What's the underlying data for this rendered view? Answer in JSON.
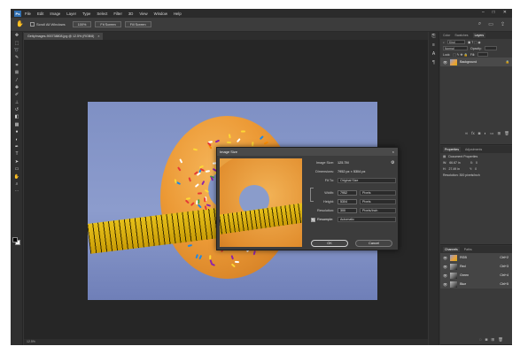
{
  "menubar": {
    "logo": "Ps",
    "items": [
      "File",
      "Edit",
      "Image",
      "Layer",
      "Type",
      "Select",
      "Filter",
      "3D",
      "View",
      "Window",
      "Help"
    ],
    "window_controls": [
      "–",
      "□",
      "✕"
    ]
  },
  "options": {
    "scroll_all": "Scroll All Windows",
    "zoom_100": "100%",
    "fit_screen": "Fit Screen",
    "fill_screen": "Fill Screen"
  },
  "document": {
    "tab_title": "GettyImages-900738808.jpg @ 12.5% (RGB/8)",
    "tab_close": "×",
    "status": "12.5%"
  },
  "panels": {
    "layers_tabs": [
      "Color",
      "Swatches",
      "Layers"
    ],
    "layers_active": "Layers",
    "kind_label": "Kind",
    "normal": "Normal",
    "opacity": "Opacity:",
    "lock": "Lock:",
    "fill": "Fill:",
    "layer_name": "Background",
    "properties_tabs": [
      "Properties",
      "Adjustments"
    ],
    "doc_props": "Document Properties",
    "w_label": "W:",
    "w_value": "66.67 in",
    "h_label": "H:",
    "h_value": "27.49 in",
    "x_label": "X:",
    "x_value": "0",
    "y_label": "Y:",
    "y_value": "0",
    "resolution": "Resolution: 300 pixels/inch",
    "channels_tabs": [
      "Channels",
      "Paths"
    ],
    "channels": [
      {
        "name": "RGB",
        "shortcut": "Ctrl+2"
      },
      {
        "name": "Red",
        "shortcut": "Ctrl+3"
      },
      {
        "name": "Green",
        "shortcut": "Ctrl+4"
      },
      {
        "name": "Blue",
        "shortcut": "Ctrl+5"
      }
    ]
  },
  "dialog": {
    "title": "Image Size",
    "close": "×",
    "image_size_label": "Image Size:",
    "image_size_value": "125.7M",
    "dimensions_label": "Dimensions:",
    "dimensions_value": "7952 px × 5304 px",
    "fit_to_label": "Fit To:",
    "fit_to_value": "Original Size",
    "width_label": "Width:",
    "width_value": "7952",
    "width_unit": "Pixels",
    "height_label": "Height:",
    "height_value": "5304",
    "height_unit": "Pixels",
    "resolution_label": "Resolution:",
    "resolution_value": "300",
    "resolution_unit": "Pixels/Inch",
    "resample_label": "Resample:",
    "resample_value": "Automatic",
    "ok": "OK",
    "cancel": "Cancel"
  },
  "colors": {
    "app_bg": "#353535",
    "canvas_bg": "#262626",
    "accent": "#2f6fb3",
    "tape": "#d8b00e",
    "donut": "#ec9a36",
    "backdrop": "#8496c7"
  }
}
